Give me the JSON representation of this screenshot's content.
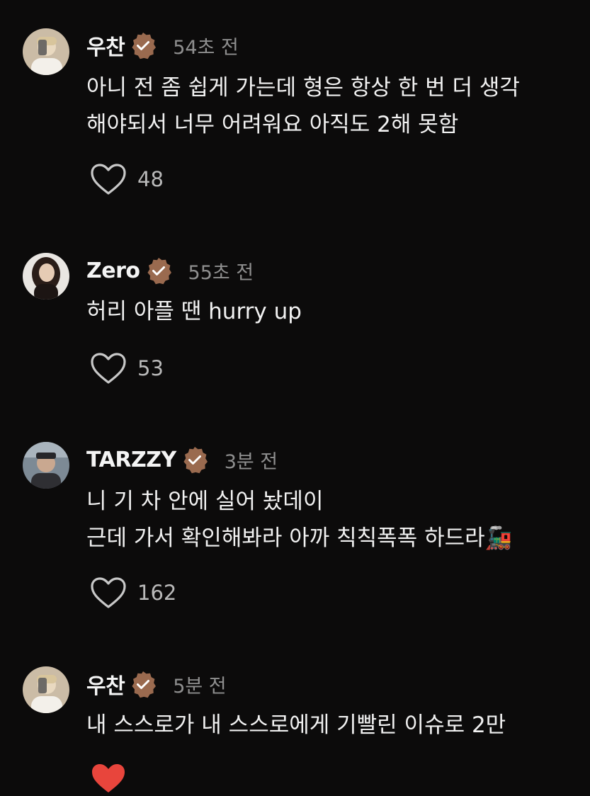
{
  "comments": [
    {
      "name": "우찬",
      "time": "54초 전",
      "text": "아니 전 좀 쉽게 가는데 형은 항상 한 번 더 생각\n해야되서 너무 어려워요 아직도 2해 못함",
      "likes": "48"
    },
    {
      "name": "Zero",
      "time": "55초 전",
      "text": "허리 아플 땐 hurry up",
      "likes": "53"
    },
    {
      "name": "TARZZY",
      "time": "3분 전",
      "text": "니 기 차 안에 실어 놨데이\n근데 가서 확인해봐라 아까 칙칙폭폭 하드라🚂",
      "likes": "162"
    },
    {
      "name": "우찬",
      "time": "5분 전",
      "text": "내 스스로가 내 스스로에게 기빨린 이슈로 2만",
      "likes": ""
    }
  ],
  "colors": {
    "badge": "#9a6a4f",
    "background": "#0c0b0b",
    "liked": "#e8453c"
  }
}
